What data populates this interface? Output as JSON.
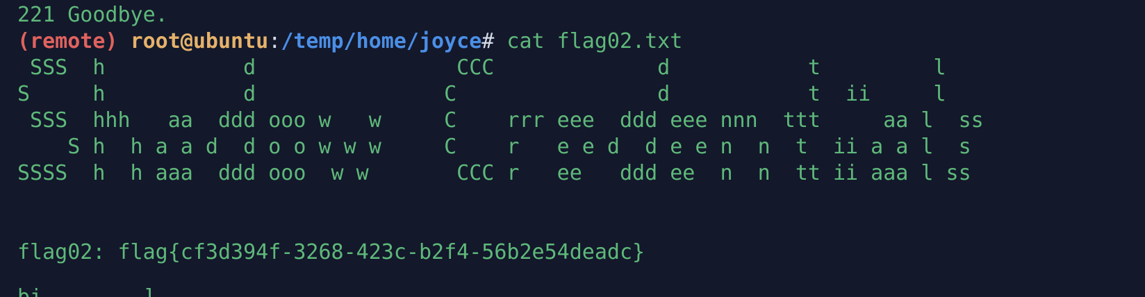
{
  "terminal": {
    "goodbye_line": "221 Goodbye.",
    "prompt": {
      "remote": "(remote)",
      "user_host": "root@ubuntu",
      "colon": ":",
      "path": "/temp/home/joyce",
      "symbol": "#",
      "command": " cat flag02.txt"
    },
    "ascii_art": [
      " SSS  h           d                CCC             d           t         l",
      "S     h           d               C                d           t  ii     l",
      " SSS  hhh   aa  ddd ooo w   w     C    rrr eee  ddd eee nnn  ttt     aa l  ss",
      "    S h  h a a d  d o o w w w     C    r   e e d  d e e n  n  t  ii a a l  s",
      "SSSS  h  h aaa  ddd ooo  w w       CCC r   ee   ddd ee  n  n  tt ii aaa l ss"
    ],
    "blank_lines": [
      "",
      ""
    ],
    "flag_line": "flag02: flag{cf3d394f-3268-423c-b2f4-56b2e54deadc}",
    "next_line_partial": "bi        ]"
  },
  "colors": {
    "background": "#13182b",
    "text_green": "#5fb97a",
    "remote_red": "#e0625e",
    "user_orange": "#e6b26a",
    "path_blue": "#4b8fe6"
  }
}
